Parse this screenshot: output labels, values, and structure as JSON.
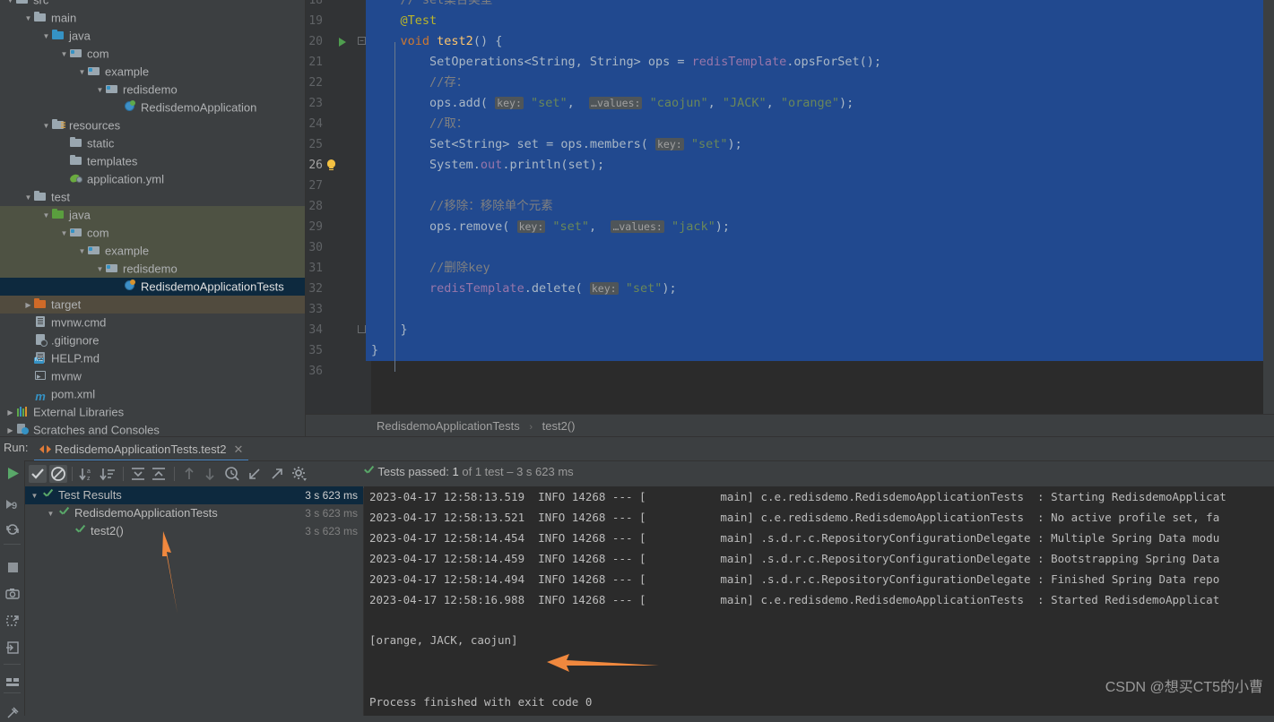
{
  "project_tree": {
    "rows": [
      {
        "indent": 1,
        "twisty": "down",
        "icon": "folder",
        "label": "src",
        "state": "none",
        "partial": true
      },
      {
        "indent": 2,
        "twisty": "down",
        "icon": "folder",
        "label": "main",
        "state": "none"
      },
      {
        "indent": 3,
        "twisty": "down",
        "icon": "folder-blue",
        "label": "java",
        "state": "none"
      },
      {
        "indent": 4,
        "twisty": "down",
        "icon": "package",
        "label": "com",
        "state": "none"
      },
      {
        "indent": 5,
        "twisty": "down",
        "icon": "package",
        "label": "example",
        "state": "none"
      },
      {
        "indent": 6,
        "twisty": "down",
        "icon": "package",
        "label": "redisdemo",
        "state": "none"
      },
      {
        "indent": 7,
        "twisty": "none",
        "icon": "spring-class",
        "label": "RedisdemoApplication",
        "state": "none"
      },
      {
        "indent": 3,
        "twisty": "down",
        "icon": "folder-resources",
        "label": "resources",
        "state": "none"
      },
      {
        "indent": 4,
        "twisty": "none",
        "icon": "folder",
        "label": "static",
        "state": "none"
      },
      {
        "indent": 4,
        "twisty": "none",
        "icon": "folder",
        "label": "templates",
        "state": "none"
      },
      {
        "indent": 4,
        "twisty": "none",
        "icon": "yml-file",
        "label": "application.yml",
        "state": "none"
      },
      {
        "indent": 2,
        "twisty": "down",
        "icon": "folder",
        "label": "test",
        "state": "none"
      },
      {
        "indent": 3,
        "twisty": "down",
        "icon": "folder-green",
        "label": "java",
        "state": "green"
      },
      {
        "indent": 4,
        "twisty": "down",
        "icon": "package",
        "label": "com",
        "state": "green"
      },
      {
        "indent": 5,
        "twisty": "down",
        "icon": "package",
        "label": "example",
        "state": "green"
      },
      {
        "indent": 6,
        "twisty": "down",
        "icon": "package",
        "label": "redisdemo",
        "state": "green"
      },
      {
        "indent": 7,
        "twisty": "none",
        "icon": "test-class",
        "label": "RedisdemoApplicationTests",
        "state": "selected"
      },
      {
        "indent": 2,
        "twisty": "right",
        "icon": "folder-orange",
        "label": "target",
        "state": "brown"
      },
      {
        "indent": 2,
        "twisty": "none",
        "icon": "cmd-file",
        "label": "mvnw.cmd",
        "state": "none"
      },
      {
        "indent": 2,
        "twisty": "none",
        "icon": "gitignore-file",
        "label": ".gitignore",
        "state": "none"
      },
      {
        "indent": 2,
        "twisty": "none",
        "icon": "md-file",
        "label": "HELP.md",
        "state": "none"
      },
      {
        "indent": 2,
        "twisty": "none",
        "icon": "bat-file",
        "label": "mvnw",
        "state": "none"
      },
      {
        "indent": 2,
        "twisty": "none",
        "icon": "maven-file",
        "label": "pom.xml",
        "state": "none"
      },
      {
        "indent": 1,
        "twisty": "right",
        "icon": "libraries",
        "label": "External Libraries",
        "state": "none"
      },
      {
        "indent": 1,
        "twisty": "right",
        "icon": "scratches",
        "label": "Scratches and Consoles",
        "state": "none"
      }
    ]
  },
  "editor": {
    "first_line": 18,
    "last_line": 36,
    "current_line": 26,
    "run_marker_line": 20,
    "bulb_line": 26,
    "lines": [
      {
        "n": 18,
        "tokens": [
          {
            "t": "    // set集合类型",
            "c": "cmt"
          }
        ]
      },
      {
        "n": 19,
        "tokens": [
          {
            "t": "    ",
            "c": "pln"
          },
          {
            "t": "@Test",
            "c": "ann"
          }
        ]
      },
      {
        "n": 20,
        "tokens": [
          {
            "t": "    ",
            "c": "pln"
          },
          {
            "t": "void",
            "c": "kw"
          },
          {
            "t": " ",
            "c": "pln"
          },
          {
            "t": "test2",
            "c": "mth"
          },
          {
            "t": "() {",
            "c": "pln"
          }
        ]
      },
      {
        "n": 21,
        "tokens": [
          {
            "t": "        SetOperations<String, String> ops = ",
            "c": "pln"
          },
          {
            "t": "redisTemplate",
            "c": "fld"
          },
          {
            "t": ".opsForSet();",
            "c": "pln"
          }
        ]
      },
      {
        "n": 22,
        "tokens": [
          {
            "t": "        //存：",
            "c": "cmt"
          }
        ]
      },
      {
        "n": 23,
        "tokens": [
          {
            "t": "        ops.add( ",
            "c": "pln"
          },
          {
            "t": "key:",
            "c": "hint"
          },
          {
            "t": " ",
            "c": "pln"
          },
          {
            "t": "\"set\"",
            "c": "str"
          },
          {
            "t": ",  ",
            "c": "pln"
          },
          {
            "t": "…values:",
            "c": "hint"
          },
          {
            "t": " ",
            "c": "pln"
          },
          {
            "t": "\"caojun\"",
            "c": "str"
          },
          {
            "t": ", ",
            "c": "pln"
          },
          {
            "t": "\"JACK\"",
            "c": "str"
          },
          {
            "t": ", ",
            "c": "pln"
          },
          {
            "t": "\"orange\"",
            "c": "str"
          },
          {
            "t": ");",
            "c": "pln"
          }
        ]
      },
      {
        "n": 24,
        "tokens": [
          {
            "t": "        //取：",
            "c": "cmt"
          }
        ]
      },
      {
        "n": 25,
        "tokens": [
          {
            "t": "        Set<String> set = ops.members( ",
            "c": "pln"
          },
          {
            "t": "key:",
            "c": "hint"
          },
          {
            "t": " ",
            "c": "pln"
          },
          {
            "t": "\"set\"",
            "c": "str"
          },
          {
            "t": ");",
            "c": "pln"
          }
        ]
      },
      {
        "n": 26,
        "tokens": [
          {
            "t": "        System.",
            "c": "pln"
          },
          {
            "t": "out",
            "c": "fld"
          },
          {
            "t": ".println(set);",
            "c": "pln"
          }
        ]
      },
      {
        "n": 27,
        "tokens": []
      },
      {
        "n": 28,
        "tokens": [
          {
            "t": "        //移除：移除单个元素",
            "c": "cmt"
          }
        ]
      },
      {
        "n": 29,
        "tokens": [
          {
            "t": "        ops.remove( ",
            "c": "pln"
          },
          {
            "t": "key:",
            "c": "hint"
          },
          {
            "t": " ",
            "c": "pln"
          },
          {
            "t": "\"set\"",
            "c": "str"
          },
          {
            "t": ",  ",
            "c": "pln"
          },
          {
            "t": "…values:",
            "c": "hint"
          },
          {
            "t": " ",
            "c": "pln"
          },
          {
            "t": "\"jack\"",
            "c": "str"
          },
          {
            "t": ");",
            "c": "pln"
          }
        ]
      },
      {
        "n": 30,
        "tokens": []
      },
      {
        "n": 31,
        "tokens": [
          {
            "t": "        //删除key",
            "c": "cmt"
          }
        ]
      },
      {
        "n": 32,
        "tokens": [
          {
            "t": "        ",
            "c": "pln"
          },
          {
            "t": "redisTemplate",
            "c": "fld"
          },
          {
            "t": ".delete( ",
            "c": "pln"
          },
          {
            "t": "key:",
            "c": "hint"
          },
          {
            "t": " ",
            "c": "pln"
          },
          {
            "t": "\"set\"",
            "c": "str"
          },
          {
            "t": ");",
            "c": "pln"
          }
        ]
      },
      {
        "n": 33,
        "tokens": []
      },
      {
        "n": 34,
        "tokens": [
          {
            "t": "    }",
            "c": "pln"
          }
        ]
      },
      {
        "n": 35,
        "tokens": [
          {
            "t": "}",
            "c": "pln"
          }
        ]
      },
      {
        "n": 36,
        "tokens": []
      }
    ]
  },
  "breadcrumb": {
    "items": [
      "RedisdemoApplicationTests",
      "test2()"
    ],
    "separator": "›"
  },
  "run_panel": {
    "run_label": "Run:",
    "tab_title": "RedisdemoApplicationTests.test2",
    "tab_close": "✕",
    "tests_passed": {
      "prefix": "Tests passed:",
      "count": "1",
      "suffix": "of 1 test – 3 s 623 ms"
    },
    "toolbar_icons": [
      "rerun-icon",
      "show-passed-icon",
      "hide-ignored-icon",
      "sort-alphabetically-icon",
      "sort-by-duration-icon",
      "expand-all-icon",
      "collapse-all-icon",
      "prev-failed-icon",
      "next-failed-icon",
      "test-history-icon",
      "import-tests-icon",
      "export-tests-icon",
      "settings-icon"
    ],
    "tree": [
      {
        "indent": 0,
        "twisty": "down",
        "label": "Test Results",
        "duration": "3 s 623 ms",
        "selected": true
      },
      {
        "indent": 1,
        "twisty": "down",
        "label": "RedisdemoApplicationTests",
        "duration": "3 s 623 ms",
        "selected": false
      },
      {
        "indent": 2,
        "twisty": "none",
        "label": "test2()",
        "duration": "3 s 623 ms",
        "selected": false
      }
    ]
  },
  "console": {
    "log_lines": [
      "2023-04-17 12:58:13.519  INFO 14268 --- [           main] c.e.redisdemo.RedisdemoApplicationTests  : Starting RedisdemoApplicat",
      "2023-04-17 12:58:13.521  INFO 14268 --- [           main] c.e.redisdemo.RedisdemoApplicationTests  : No active profile set, fa",
      "2023-04-17 12:58:14.454  INFO 14268 --- [           main] .s.d.r.c.RepositoryConfigurationDelegate : Multiple Spring Data modu",
      "2023-04-17 12:58:14.459  INFO 14268 --- [           main] .s.d.r.c.RepositoryConfigurationDelegate : Bootstrapping Spring Data",
      "2023-04-17 12:58:14.494  INFO 14268 --- [           main] .s.d.r.c.RepositoryConfigurationDelegate : Finished Spring Data repo",
      "2023-04-17 12:58:16.988  INFO 14268 --- [           main] c.e.redisdemo.RedisdemoApplicationTests  : Started RedisdemoApplicat"
    ],
    "output_line": "[orange, JACK, caojun]",
    "exit_line": "Process finished with exit code 0"
  },
  "left_toolstrip": [
    "run-icon",
    "debug-icon",
    "profiler-icon",
    "stop-icon",
    "screenshot-icon",
    "rerun-failed-icon",
    "exit-icon",
    "layout-icon",
    "pin-icon"
  ],
  "annotations": {
    "arrow_color": "#f0883e",
    "arrow_test_tree": "points-to-test2-node",
    "arrow_console_output": "points-to-output-line"
  },
  "watermark": "CSDN @想买CT5的小曹",
  "colors": {
    "bg_panel": "#3c3f41",
    "bg_editor": "#2b2b2b",
    "gutter": "#313335",
    "selection_blue": "#21498f",
    "tree_sel_blue": "#0d293e",
    "tree_sel_green": "#4e5243",
    "tree_sel_brown": "#514b3e",
    "accent_green": "#59a869",
    "accent_orange": "#f0883e",
    "tab_underline": "#4a88c7"
  }
}
